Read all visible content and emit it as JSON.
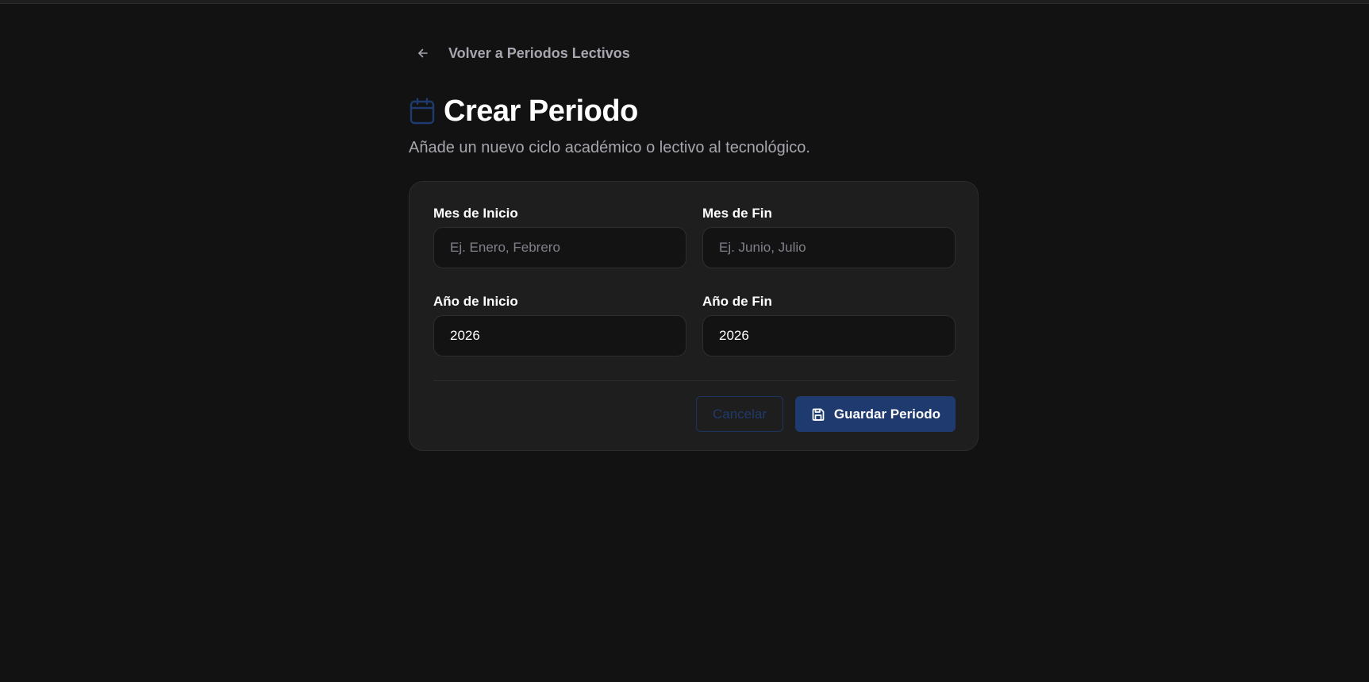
{
  "back_link": {
    "label": "Volver a Periodos Lectivos",
    "icon": "arrow-left-icon"
  },
  "header": {
    "title": "Crear Periodo",
    "subtitle": "Añade un nuevo ciclo académico o lectivo al tecnológico.",
    "icon": "calendar-icon"
  },
  "form": {
    "mes_inicio": {
      "label": "Mes de Inicio",
      "placeholder": "Ej. Enero, Febrero",
      "value": ""
    },
    "mes_fin": {
      "label": "Mes de Fin",
      "placeholder": "Ej. Junio, Julio",
      "value": ""
    },
    "anio_inicio": {
      "label": "Año de Inicio",
      "placeholder": "",
      "value": "2026"
    },
    "anio_fin": {
      "label": "Año de Fin",
      "placeholder": "",
      "value": "2026"
    }
  },
  "actions": {
    "cancel_label": "Cancelar",
    "save_label": "Guardar Periodo",
    "save_icon": "save-icon"
  },
  "colors": {
    "background": "#121212",
    "card": "#1e1e1e",
    "accent": "#1e3a6e",
    "muted_text": "#a6a6ae"
  }
}
